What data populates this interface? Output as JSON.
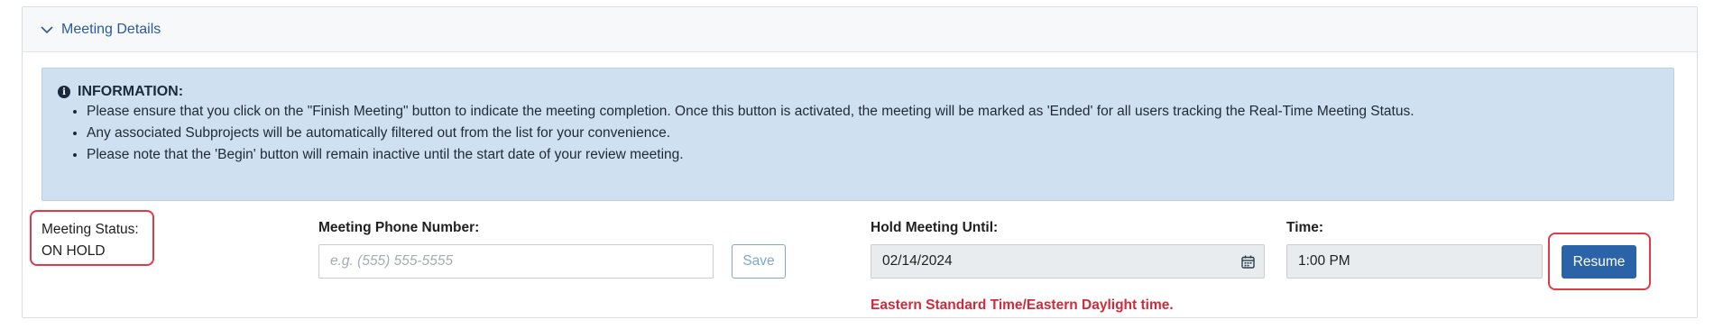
{
  "panel": {
    "title": "Meeting Details"
  },
  "info": {
    "heading": "INFORMATION:",
    "items": [
      "Please ensure that you click on the \"Finish Meeting\" button to indicate the meeting completion. Once this button is activated, the meeting will be marked as 'Ended' for all users tracking the Real-Time Meeting Status.",
      "Any associated Subprojects will be automatically filtered out from the list for your convenience.",
      "Please note that the 'Begin' button will remain inactive until the start date of your review meeting."
    ]
  },
  "status": {
    "label": "Meeting Status:",
    "value": "ON HOLD"
  },
  "phone": {
    "label": "Meeting Phone Number:",
    "placeholder": "e.g. (555) 555-5555",
    "save_label": "Save"
  },
  "hold": {
    "label": "Hold Meeting Until:",
    "value": "02/14/2024",
    "note": "Eastern Standard Time/Eastern Daylight time."
  },
  "time": {
    "label": "Time:",
    "value": "1:00 PM"
  },
  "actions": {
    "resume_label": "Resume"
  },
  "colors": {
    "highlight": "#e03a4a",
    "primary": "#2a63a8",
    "link": "#2a5b97",
    "warning_text": "#d02a3a"
  }
}
